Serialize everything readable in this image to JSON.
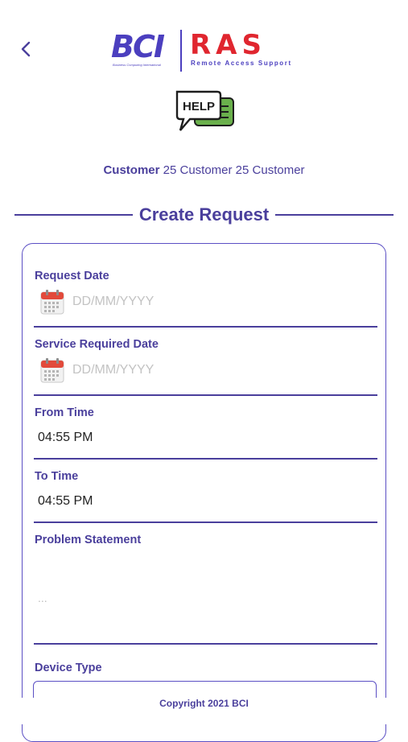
{
  "header": {
    "back_icon": "chevron-left-icon",
    "logo": {
      "bci_text": "BCI",
      "bci_tagline": "Business Computing International",
      "ras_text": "RAS",
      "ras_tagline": "Remote Access Support"
    },
    "help_icon_label": "HELP"
  },
  "user": {
    "prefix": "Customer",
    "name": "25 Customer 25 Customer"
  },
  "section_title": "Create Request",
  "form": {
    "request_date": {
      "label": "Request Date",
      "placeholder": "DD/MM/YYYY",
      "icon": "calendar-icon"
    },
    "service_date": {
      "label": "Service Required Date",
      "placeholder": "DD/MM/YYYY",
      "icon": "calendar-icon"
    },
    "from_time": {
      "label": "From Time",
      "value": "04:55 PM"
    },
    "to_time": {
      "label": "To Time",
      "value": "04:55 PM"
    },
    "problem_statement": {
      "label": "Problem Statement",
      "placeholder": "..."
    },
    "device_type": {
      "label": "Device Type",
      "value": ""
    }
  },
  "footer": {
    "copyright": "Copyright 2021 BCI"
  },
  "colors": {
    "primary": "#4a3f9c",
    "brand_blue": "#4b3fbf",
    "brand_red": "#e0262f",
    "help_green": "#6ab04c"
  }
}
